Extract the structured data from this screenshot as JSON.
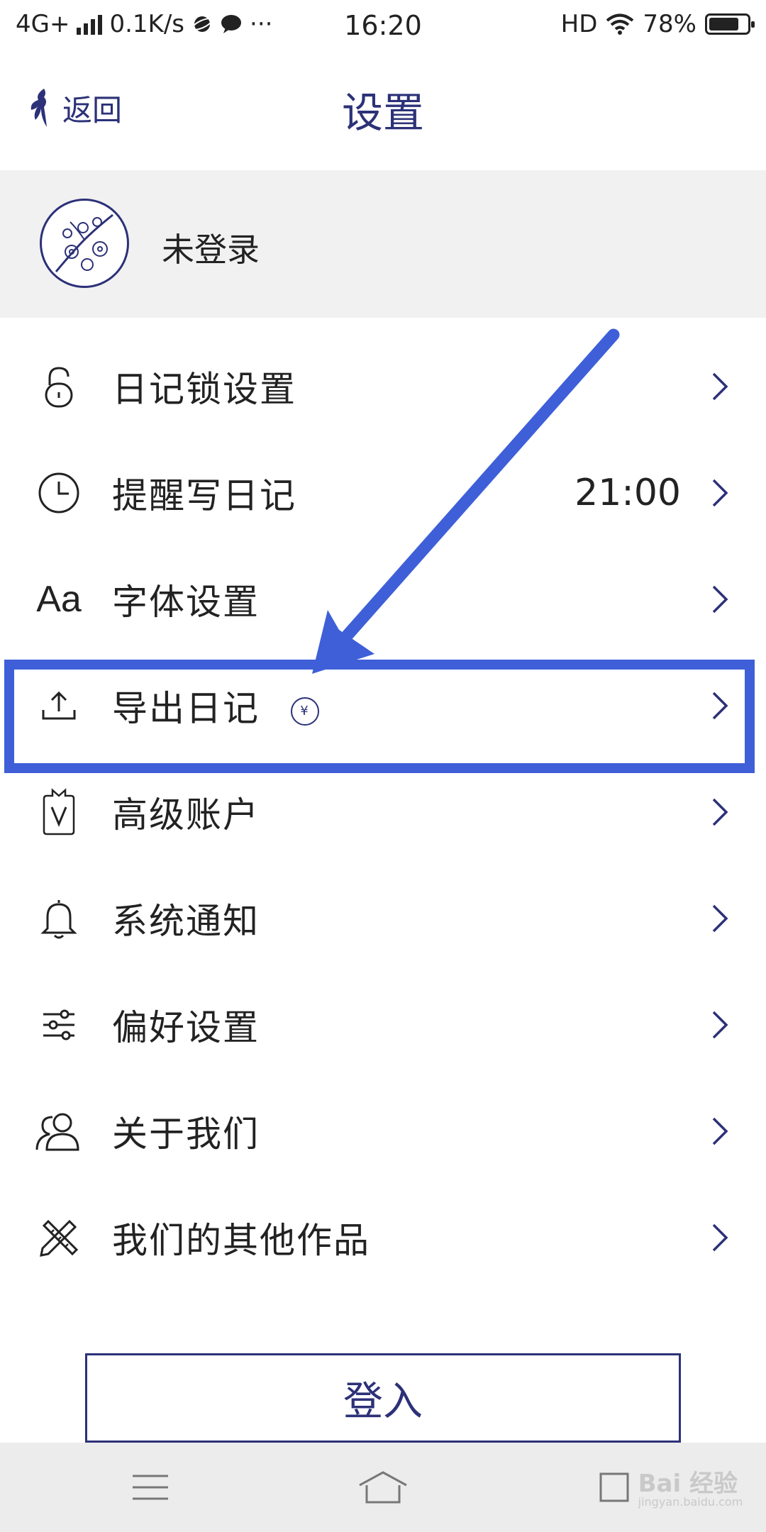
{
  "status_bar": {
    "network": "4G+",
    "speed": "0.1K/s",
    "more": "···",
    "time": "16:20",
    "hd": "HD",
    "battery": "78%",
    "battery_level": 0.78
  },
  "header": {
    "back_label": "返回",
    "title": "设置"
  },
  "profile": {
    "name": "未登录"
  },
  "menu": {
    "items": [
      {
        "label": "日记锁设置",
        "icon": "lock-icon"
      },
      {
        "label": "提醒写日记",
        "icon": "clock-icon",
        "value": "21:00"
      },
      {
        "label": "字体设置",
        "icon": "font-icon",
        "icon_text": "Aa"
      },
      {
        "label": "导出日记",
        "icon": "upload-icon",
        "badge": "¥"
      },
      {
        "label": "高级账户",
        "icon": "vip-badge-icon"
      },
      {
        "label": "系统通知",
        "icon": "bell-icon"
      },
      {
        "label": "偏好设置",
        "icon": "sliders-icon"
      },
      {
        "label": "关于我们",
        "icon": "people-icon"
      },
      {
        "label": "我们的其他作品",
        "icon": "pencil-ruler-icon"
      }
    ]
  },
  "login_button": "登入",
  "watermark": {
    "text": "Bai 经验",
    "url": "jingyan.baidu.com"
  },
  "colors": {
    "accent": "#2c3178",
    "highlight": "#3e5fd8",
    "profile_bg": "#f1f1f1",
    "nav_bg": "#ececec"
  }
}
